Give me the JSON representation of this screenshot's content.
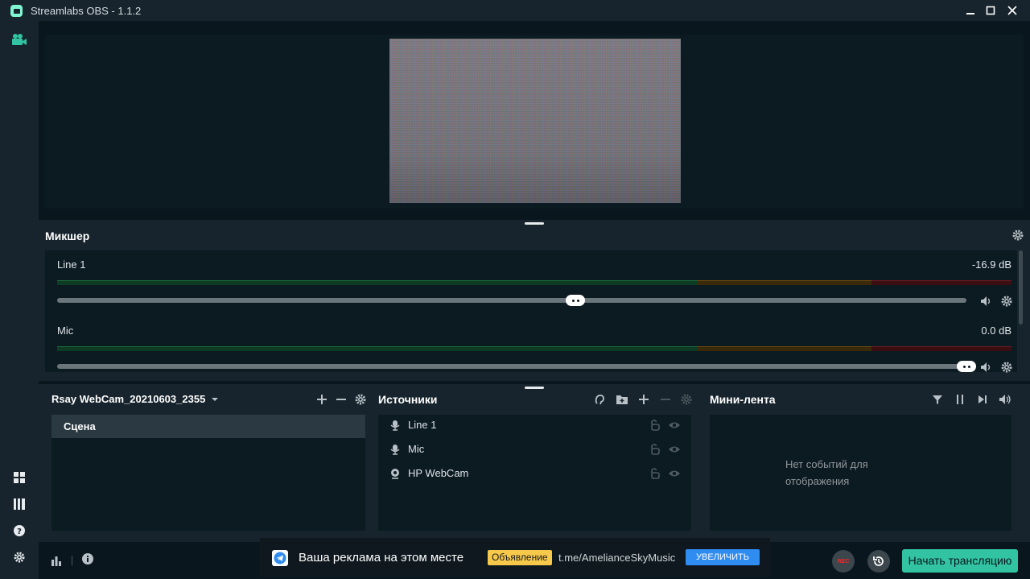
{
  "window": {
    "title": "Streamlabs OBS - 1.1.2"
  },
  "colors": {
    "accent": "#31c3a2",
    "background": "#09161d",
    "panel": "#17242d",
    "rec": "#e0302f",
    "ad_badge": "#f6c94b",
    "ad_button": "#2f8cf0"
  },
  "mixer": {
    "title": "Микшер",
    "channels": [
      {
        "name": "Line 1",
        "db": "-16.9 dB",
        "volume": 0.57
      },
      {
        "name": "Mic",
        "db": "0.0 dB",
        "volume": 1.0
      }
    ]
  },
  "scenes": {
    "collection": "Rsay WebCam_20210603_2355",
    "items": [
      {
        "name": "Сцена",
        "selected": true
      }
    ]
  },
  "sources": {
    "title": "Источники",
    "items": [
      {
        "name": "Line 1",
        "icon": "mic-icon"
      },
      {
        "name": "Mic",
        "icon": "mic-icon"
      },
      {
        "name": "HP WebCam",
        "icon": "webcam-icon"
      }
    ]
  },
  "minifeed": {
    "title": "Мини-лента",
    "empty_line1": "Нет событий для",
    "empty_line2": "отображения"
  },
  "ad": {
    "text": "Ваша реклама на этом месте",
    "badge": "Объявление",
    "link": "t.me/AmelianceSkyMusic",
    "button": "УВЕЛИЧИТЬ"
  },
  "footer": {
    "rec_label": "REC",
    "go_live_label": "Начать трансляцию"
  }
}
